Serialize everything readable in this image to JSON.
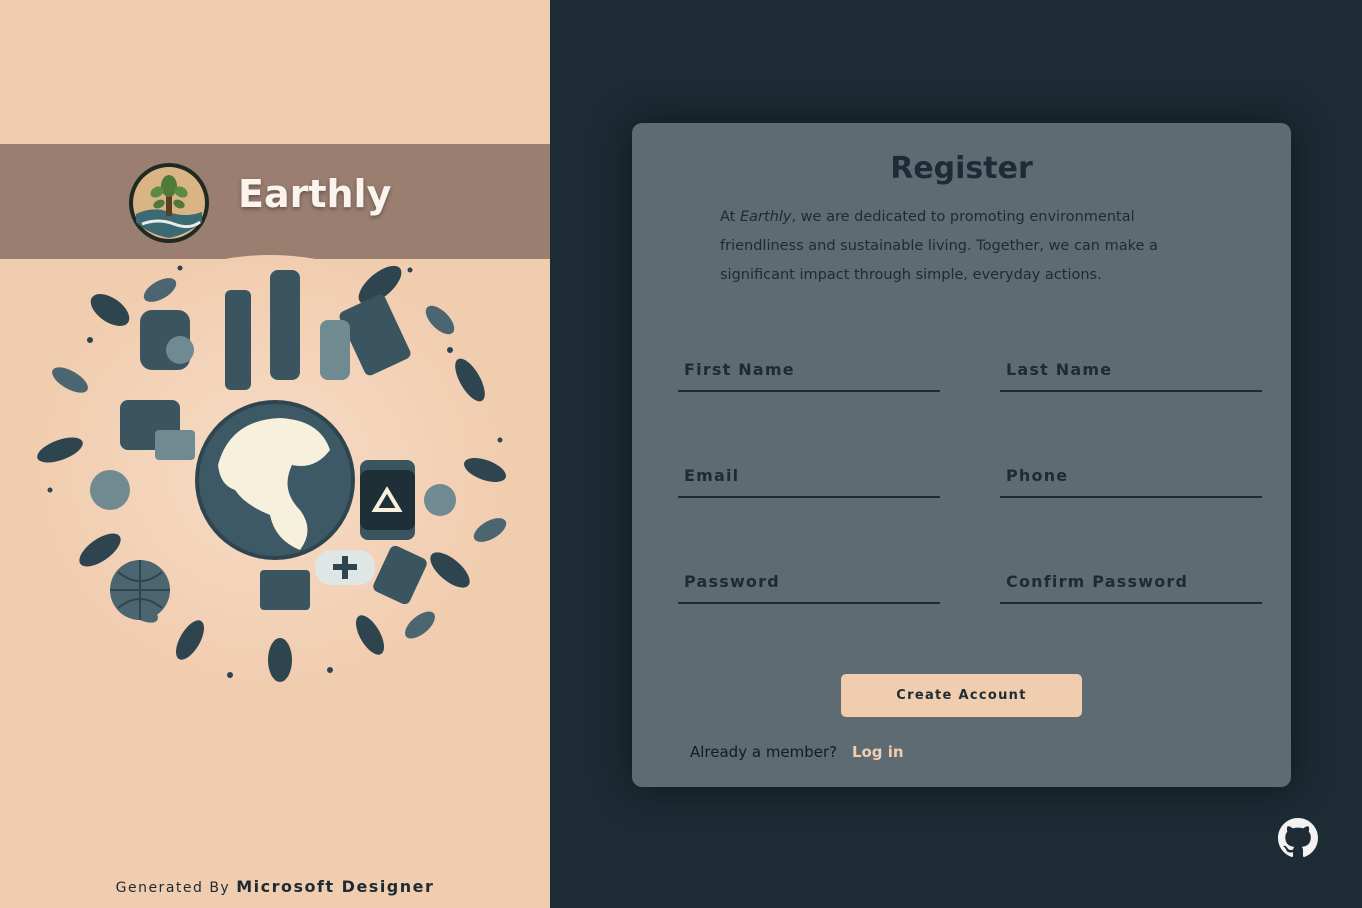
{
  "brand": {
    "name": "Earthly"
  },
  "credit": {
    "prefix": "Generated By",
    "source": "Microsoft Designer"
  },
  "form": {
    "title": "Register",
    "intro_prefix": "At ",
    "intro_brand": "Earthly",
    "intro_rest": ", we are dedicated to promoting environmental friendliness and sustainable living. Together, we can make a significant impact through simple, everyday actions.",
    "fields": {
      "first_name": "First Name",
      "last_name": "Last Name",
      "email": "Email",
      "phone": "Phone",
      "password": "Password",
      "confirm_password": "Confirm Password"
    },
    "submit_label": "Create Account",
    "login_prompt": "Already a member?",
    "login_link": "Log in"
  },
  "colors": {
    "background": "#1c2b34",
    "panel": "#f1cdb0",
    "brand_bar": "#9a7e70",
    "card": "#5e6b73",
    "accent": "#f1cdb0",
    "text_dark": "#1c2b34"
  },
  "icons": {
    "logo": "tree-globe-logo",
    "illustration": "eco-globe-collage",
    "footer": "github-icon"
  }
}
